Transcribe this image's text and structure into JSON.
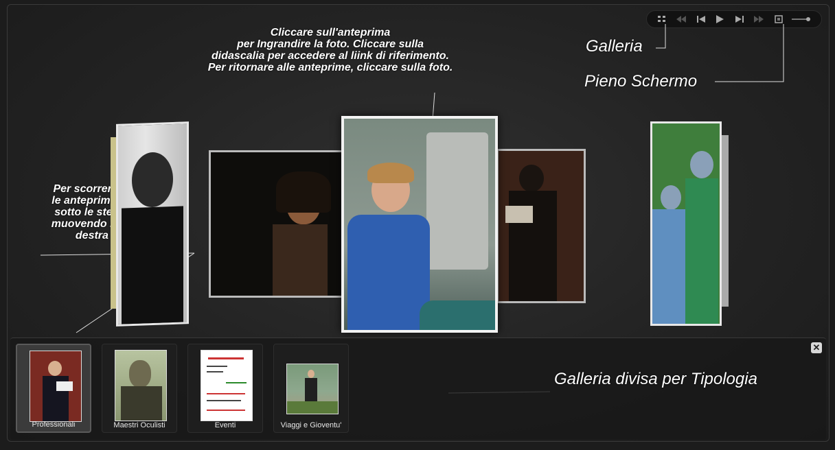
{
  "annotations": {
    "center_text": "Cliccare sull'anteprima\nper Ingrandire la foto. Cliccare sulla\ndidascalia per accedere al liink di riferimento.\nPer ritornare alle anteprime, cliccare sulla foto.",
    "left_text": "Per scorrere e far ruotare\nle anteprime, posizionarsi\nsotto le stesse e cliccare\nmuovendo il mouse verso\ndestra e sinistra.",
    "galleria": "Galleria",
    "pieno_schermo": "Pieno Schermo",
    "galleria_divisa": "Galleria divisa per Tipologia"
  },
  "controls": [
    "grid-icon",
    "rewind-icon",
    "previous-icon",
    "play-icon",
    "next-icon",
    "fast-forward-icon",
    "fullscreen-icon",
    "volume-slider"
  ],
  "gallery": {
    "items": [
      {
        "label": "Professionali",
        "selected": true
      },
      {
        "label": "Maestri Oculisti",
        "selected": false
      },
      {
        "label": "Eventi",
        "selected": false
      },
      {
        "label": "Viaggi e Gioventu'",
        "selected": false
      }
    ],
    "close_label": "✕"
  },
  "colors": {
    "background": "#1c1c1c",
    "surgical_blue": "#2f5fb0",
    "surgical_green": "#2f8a52"
  }
}
